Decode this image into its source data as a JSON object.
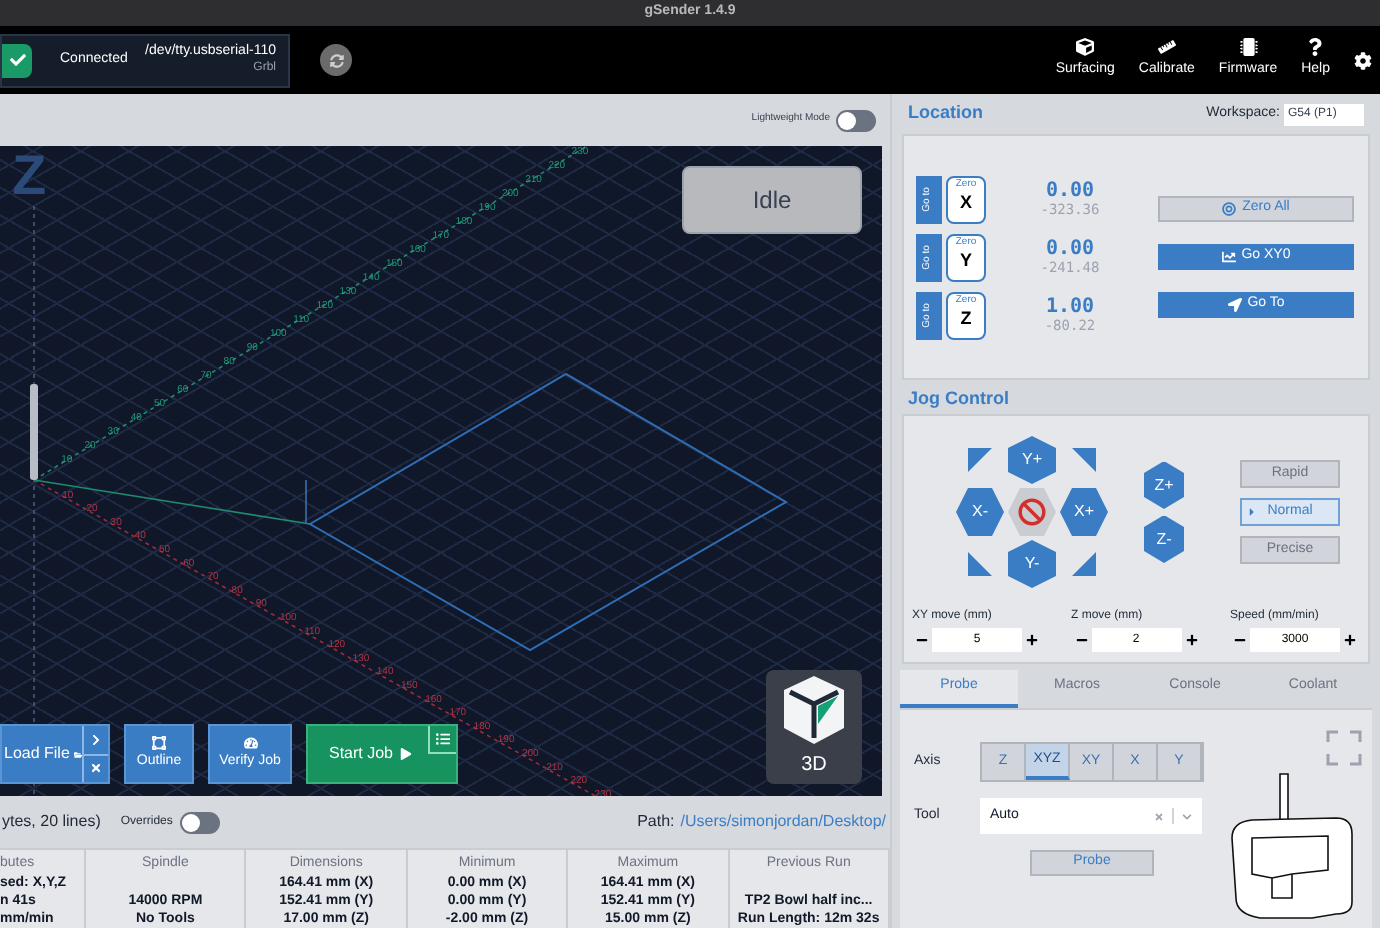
{
  "window": {
    "title": "gSender 1.4.9"
  },
  "connection": {
    "connected": true,
    "status": "Connected",
    "port": "/dev/tty.usbserial-110",
    "firmware": "Grbl"
  },
  "toolbar": [
    {
      "kind": "surfacing",
      "label": "Surfacing"
    },
    {
      "kind": "calibrate",
      "label": "Calibrate"
    },
    {
      "kind": "firmware",
      "label": "Firmware"
    },
    {
      "kind": "help",
      "label": "Help"
    }
  ],
  "visualizer": {
    "lightweight_mode": {
      "label": "Lightweight Mode",
      "on": false
    },
    "axis_label": "Z",
    "state": "Idle",
    "y_ticks": [
      "10",
      "20",
      "30",
      "40",
      "50",
      "60",
      "70",
      "80",
      "90",
      "100",
      "110",
      "120",
      "130",
      "140",
      "150",
      "160",
      "170",
      "180",
      "190",
      "200",
      "210",
      "220",
      "230"
    ],
    "x_ticks": [
      "10",
      "20",
      "30",
      "40",
      "50",
      "60",
      "70",
      "80",
      "90",
      "100",
      "110",
      "120",
      "130",
      "140",
      "150",
      "160",
      "170",
      "180",
      "190",
      "200",
      "210",
      "220",
      "230"
    ],
    "buttons": [
      {
        "kind": "load",
        "label": "Load File"
      },
      {
        "kind": "outline",
        "label": "Outline"
      },
      {
        "kind": "verify",
        "label": "Verify Job"
      },
      {
        "kind": "start",
        "label": "Start Job"
      }
    ],
    "view": "3D"
  },
  "file_info": {
    "summary": "ytes, 20 lines)",
    "overrides": {
      "label": "Overrides",
      "on": false
    },
    "path_label": "Path:",
    "path": "/Users/simonjordan/Desktop/",
    "columns": [
      {
        "heading": "butes",
        "lines": [
          "sed: X,Y,Z",
          "n 41s",
          "mm/min"
        ]
      },
      {
        "heading": "Spindle",
        "lines": [
          "14000 RPM",
          "No Tools"
        ]
      },
      {
        "heading": "Dimensions",
        "lines": [
          "164.41 mm (X)",
          "152.41 mm (Y)",
          "17.00 mm (Z)"
        ]
      },
      {
        "heading": "Minimum",
        "lines": [
          "0.00 mm (X)",
          "0.00 mm (Y)",
          "-2.00 mm (Z)"
        ]
      },
      {
        "heading": "Maximum",
        "lines": [
          "164.41 mm (X)",
          "152.41 mm (Y)",
          "15.00 mm (Z)"
        ]
      },
      {
        "heading": "Previous Run",
        "lines": [
          "TP2 Bowl half inc...",
          "Run Length: 12m 32s"
        ]
      }
    ]
  },
  "location": {
    "title": "Location",
    "workspace_label": "Workspace:",
    "workspace": "G54 (P1)",
    "axes": [
      {
        "goto": "Go to",
        "zero": "Zero",
        "axis": "X",
        "value": "0.00",
        "machine": "-323.36"
      },
      {
        "goto": "Go to",
        "zero": "Zero",
        "axis": "Y",
        "value": "0.00",
        "machine": "-241.48"
      },
      {
        "goto": "Go to",
        "zero": "Zero",
        "axis": "Z",
        "value": "1.00",
        "machine": "-80.22"
      }
    ],
    "actions": [
      {
        "kind": "zero_all",
        "label": "Zero All"
      },
      {
        "kind": "go_xy0",
        "label": "Go XY0"
      },
      {
        "kind": "go_to",
        "label": "Go To"
      }
    ]
  },
  "jog": {
    "title": "Jog Control",
    "y_plus": "Y+",
    "x_minus": "X-",
    "x_plus": "X+",
    "y_minus": "Y-",
    "z_plus": "Z+",
    "z_minus": "Z-",
    "modes": [
      {
        "label": "Rapid",
        "selected": false
      },
      {
        "label": "Normal",
        "selected": true
      },
      {
        "label": "Precise",
        "selected": false
      }
    ],
    "inputs": [
      {
        "label": "XY move (mm)",
        "value": "5"
      },
      {
        "label": "Z move (mm)",
        "value": "2"
      },
      {
        "label": "Speed (mm/min)",
        "value": "3000"
      }
    ]
  },
  "tabs": [
    {
      "label": "Probe",
      "selected": true
    },
    {
      "label": "Macros",
      "selected": false
    },
    {
      "label": "Console",
      "selected": false
    },
    {
      "label": "Coolant",
      "selected": false
    }
  ],
  "probe": {
    "axis_label": "Axis",
    "axes": [
      {
        "label": "Z",
        "selected": false
      },
      {
        "label": "XYZ",
        "selected": true
      },
      {
        "label": "XY",
        "selected": false
      },
      {
        "label": "X",
        "selected": false
      },
      {
        "label": "Y",
        "selected": false
      }
    ],
    "tool_label": "Tool",
    "tool": "Auto",
    "button": "Probe"
  }
}
